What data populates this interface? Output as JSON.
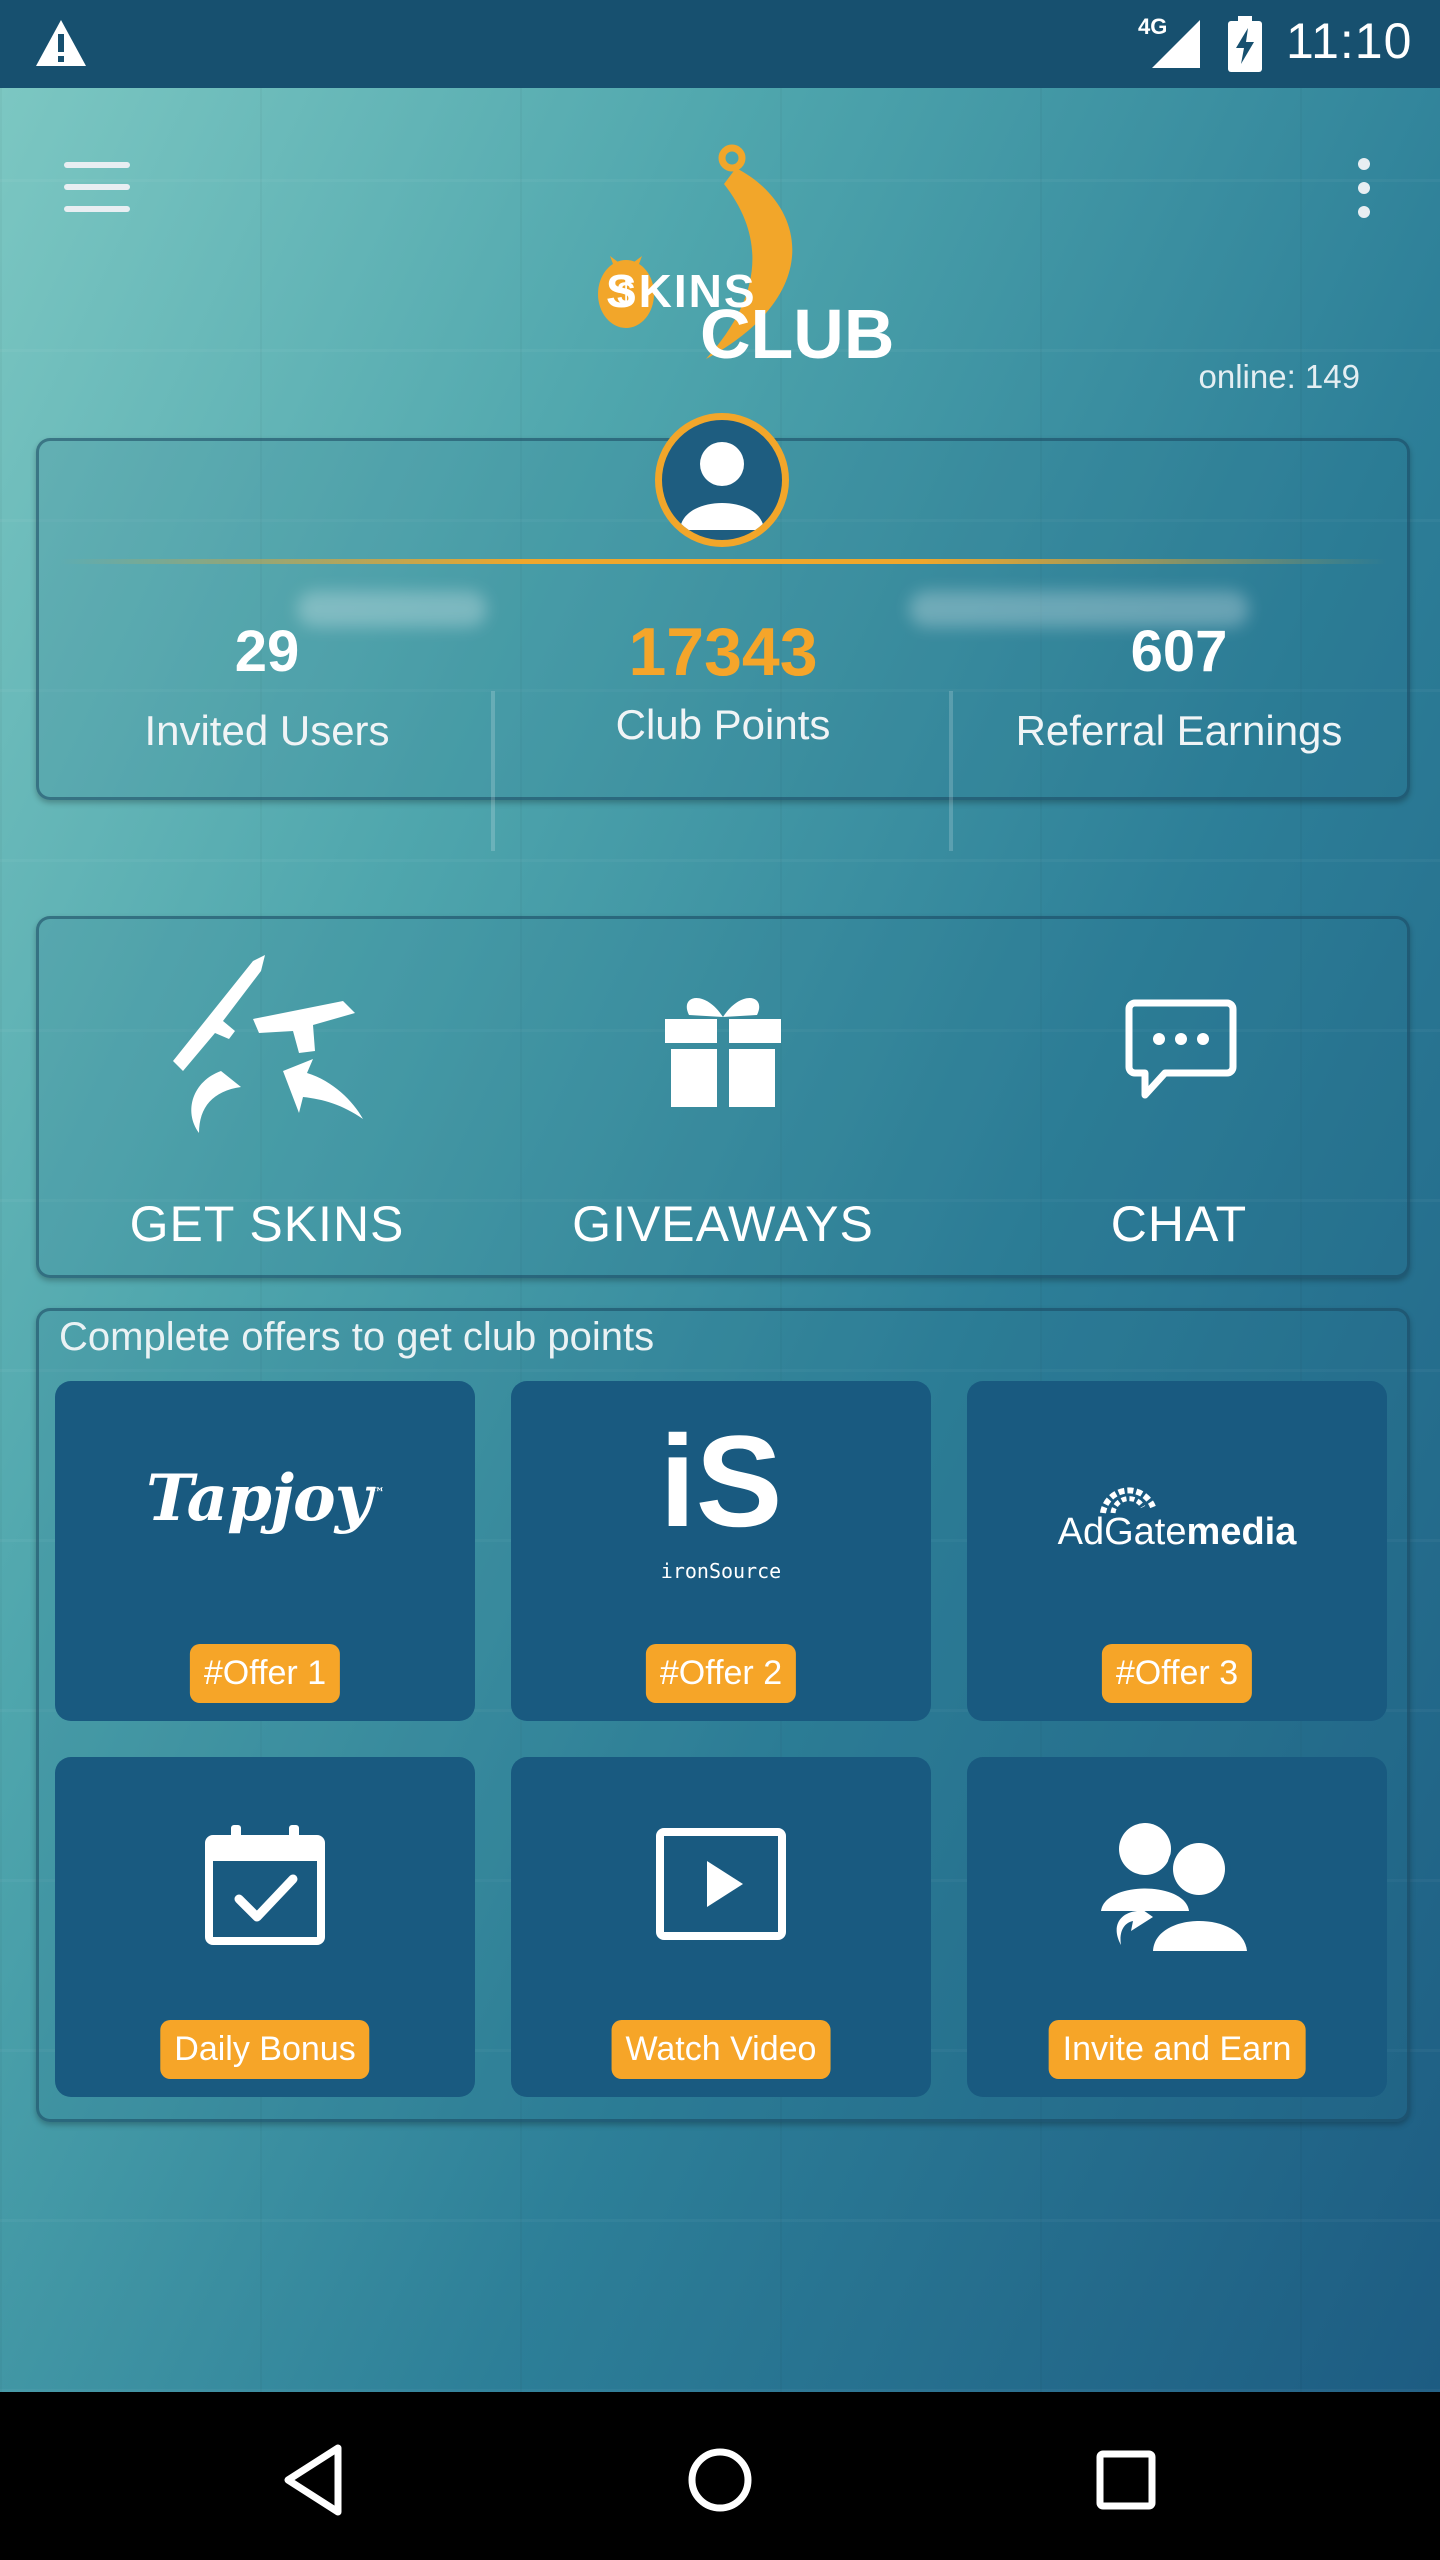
{
  "status_bar": {
    "time": "11:10",
    "network": "4G"
  },
  "header": {
    "logo_line1": "SKINS",
    "logo_line2": "CLUB",
    "online": "online: 149"
  },
  "stats": [
    {
      "value": "29",
      "label": "Invited Users"
    },
    {
      "value": "17343",
      "label": "Club Points"
    },
    {
      "value": "607",
      "label": "Referral Earnings"
    }
  ],
  "actions": [
    {
      "label": "GET SKINS",
      "icon": "weapons-icon"
    },
    {
      "label": "GIVEAWAYS",
      "icon": "gift-icon"
    },
    {
      "label": "CHAT",
      "icon": "chat-bubble-icon"
    }
  ],
  "offers": {
    "title": "Complete offers to get club points",
    "tiles": [
      {
        "brand": "Tapjoy",
        "brand_mark": "™",
        "badge": "#Offer 1"
      },
      {
        "brand": "iS",
        "brand_sub": "ironSource",
        "badge": "#Offer 2"
      },
      {
        "brand_a": "AdGate",
        "brand_b": "media",
        "badge": "#Offer 3"
      },
      {
        "icon": "calendar-check-icon",
        "badge": "Daily Bonus"
      },
      {
        "icon": "play-video-icon",
        "badge": "Watch Video"
      },
      {
        "icon": "invite-users-icon",
        "badge": "Invite and Earn"
      }
    ]
  },
  "colors": {
    "accent": "#f5a52a",
    "tile": "#195a80",
    "status_bar": "#17506f"
  }
}
